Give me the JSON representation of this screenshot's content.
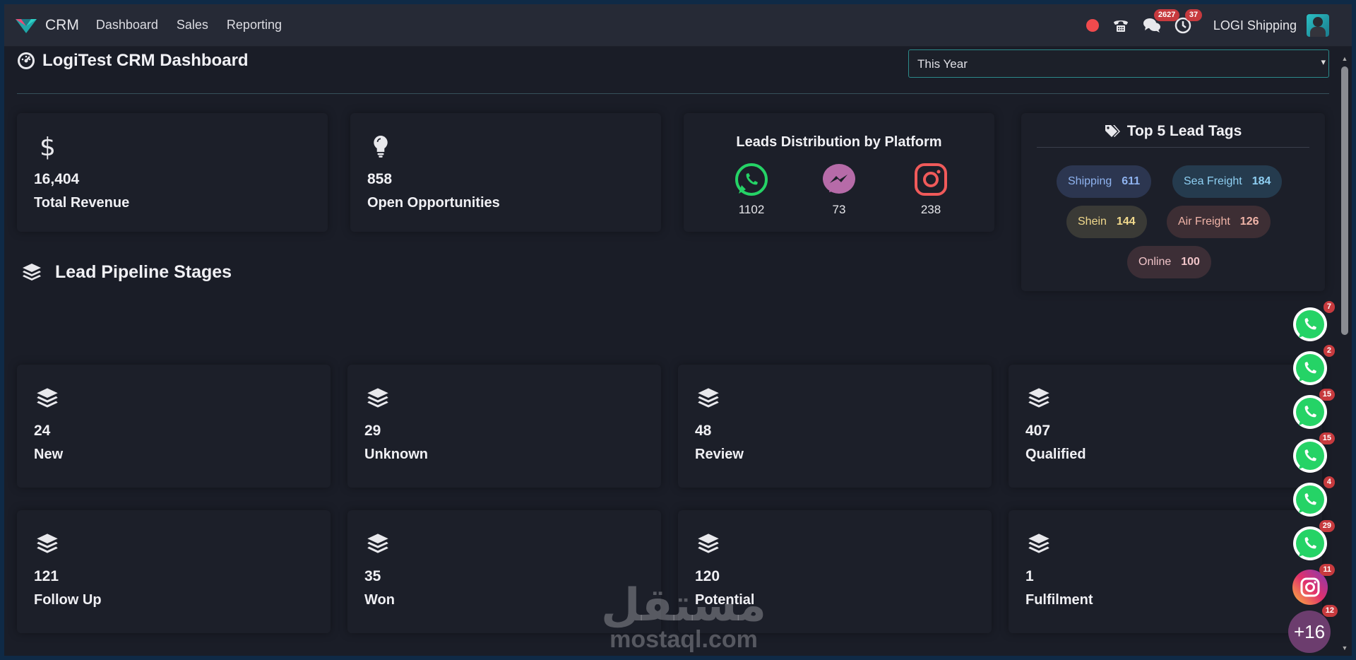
{
  "navbar": {
    "brand": "CRM",
    "menu": [
      "Dashboard",
      "Sales",
      "Reporting"
    ],
    "messages_badge": "2627",
    "activities_badge": "37",
    "company": "LOGI Shipping"
  },
  "header": {
    "title": "LogiTest CRM Dashboard",
    "period": "This Year"
  },
  "kpis": [
    {
      "value": "16,404",
      "label": "Total Revenue",
      "icon": "dollar-icon"
    },
    {
      "value": "858",
      "label": "Open Opportunities",
      "icon": "lightbulb-icon"
    }
  ],
  "platforms": {
    "title": "Leads Distribution by Platform",
    "items": [
      {
        "name": "whatsapp",
        "count": "1102",
        "color": "#25d366"
      },
      {
        "name": "messenger",
        "count": "73",
        "color": "#b66ba8"
      },
      {
        "name": "instagram",
        "count": "238",
        "color": "#f05a5a"
      }
    ]
  },
  "tags": {
    "title": "Top 5 Lead Tags",
    "items": [
      {
        "name": "Shipping",
        "count": "611",
        "bg": "#2c3650",
        "fg": "#8fb3ef"
      },
      {
        "name": "Sea Freight",
        "count": "184",
        "bg": "#253b4e",
        "fg": "#8fd0f3"
      },
      {
        "name": "Shein",
        "count": "144",
        "bg": "#3a3a36",
        "fg": "#f2da8d"
      },
      {
        "name": "Air Freight",
        "count": "126",
        "bg": "#3d2e34",
        "fg": "#f0b4a8"
      },
      {
        "name": "Online",
        "count": "100",
        "bg": "#3c2e36",
        "fg": "#f0c4c8"
      }
    ]
  },
  "pipeline": {
    "title": "Lead Pipeline Stages",
    "stages": [
      {
        "value": "24",
        "label": "New"
      },
      {
        "value": "29",
        "label": "Unknown"
      },
      {
        "value": "48",
        "label": "Review"
      },
      {
        "value": "407",
        "label": "Qualified"
      },
      {
        "value": "121",
        "label": "Follow Up"
      },
      {
        "value": "35",
        "label": "Won"
      },
      {
        "value": "120",
        "label": "Potential"
      },
      {
        "value": "1",
        "label": "Fulfilment"
      }
    ]
  },
  "floating_chats": [
    {
      "type": "whatsapp",
      "badge": "7"
    },
    {
      "type": "whatsapp",
      "badge": "2"
    },
    {
      "type": "whatsapp",
      "badge": "15"
    },
    {
      "type": "whatsapp",
      "badge": "15"
    },
    {
      "type": "whatsapp",
      "badge": "4"
    },
    {
      "type": "whatsapp",
      "badge": "29"
    },
    {
      "type": "instagram",
      "badge": "11"
    }
  ],
  "more_chats": {
    "label": "+16",
    "badge": "12"
  },
  "watermark": {
    "arabic": "مستقل",
    "latin": "mostaql.com"
  }
}
